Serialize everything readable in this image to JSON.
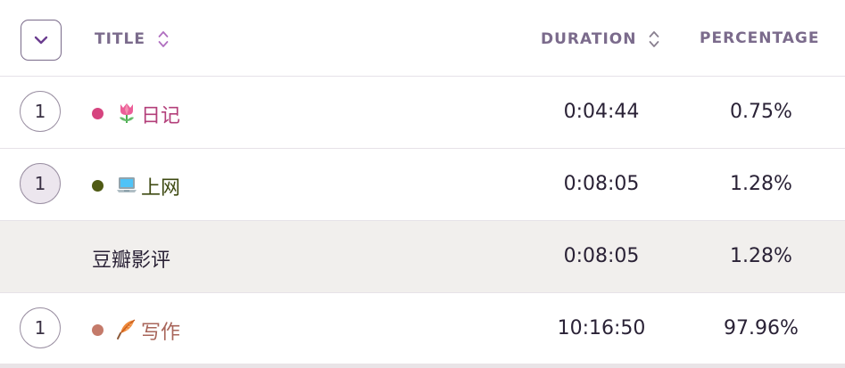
{
  "header": {
    "title_label": "TITLE",
    "duration_label": "DURATION",
    "percentage_label": "PERCENTAGE",
    "collapse_icon": "chevron-down-icon",
    "sort_icon": "sort-updown-icon"
  },
  "rows": [
    {
      "count": "1",
      "dot_color": "#d6447f",
      "emoji": "tulip",
      "title": "日记",
      "title_color": "#b33f7a",
      "duration": "0:04:44",
      "percentage": "0.75%"
    },
    {
      "count": "1",
      "dot_color": "#4f5a14",
      "emoji": "laptop",
      "title": "上网",
      "title_color": "#3e4a12",
      "duration": "0:08:05",
      "percentage": "1.28%"
    },
    {
      "title": "豆瓣影评",
      "duration": "0:08:05",
      "percentage": "1.28%"
    },
    {
      "count": "1",
      "dot_color": "#c47a6a",
      "emoji": "feather",
      "title": "写作",
      "title_color": "#a8655a",
      "duration": "10:16:50",
      "percentage": "97.96%"
    }
  ],
  "colors": {
    "header_text": "#7b6b8c",
    "subrow_bg": "#f1efed",
    "border": "#e6e2e8"
  }
}
